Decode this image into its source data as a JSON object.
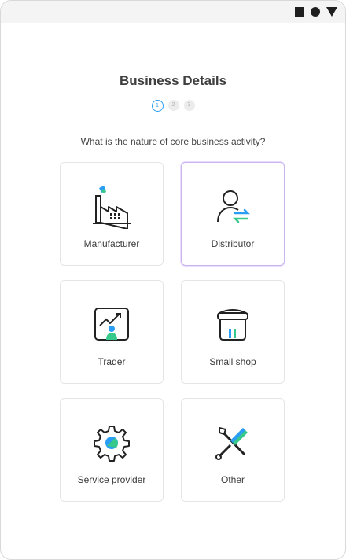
{
  "header": {
    "title": "Business Details"
  },
  "stepper": {
    "steps": [
      "1",
      "2",
      "3"
    ],
    "active": 1
  },
  "question": "What is the nature of core business activity?",
  "options": [
    {
      "label": "Manufacturer",
      "icon": "factory-icon",
      "selected": false
    },
    {
      "label": "Distributor",
      "icon": "person-transfer-icon",
      "selected": true
    },
    {
      "label": "Trader",
      "icon": "trading-chart-icon",
      "selected": false
    },
    {
      "label": "Small shop",
      "icon": "shop-jar-icon",
      "selected": false
    },
    {
      "label": "Service provider",
      "icon": "gear-icon",
      "selected": false
    },
    {
      "label": "Other",
      "icon": "tools-icon",
      "selected": false
    }
  ],
  "colors": {
    "accent_blue": "#2a9df4",
    "accent_green": "#37c98b",
    "selected_border": "#c9b6f0"
  }
}
